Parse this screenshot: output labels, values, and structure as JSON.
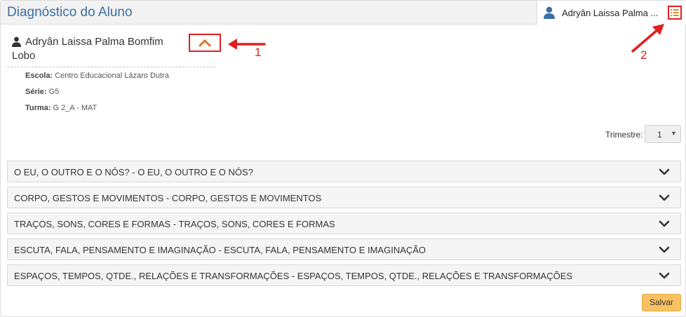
{
  "header": {
    "title": "Diagnóstico do Aluno",
    "user_tab_name": "Adryân Laissa Palma ...",
    "user_icon": "user-icon",
    "list_icon": "list-icon"
  },
  "student": {
    "name": "Adryân Laissa Palma Bomfim Lobo",
    "person_icon": "person-icon",
    "collapse_icon": "chevron-up-icon",
    "escola_label": "Escola:",
    "escola_value": " Centro Educacional Lázaro Dutra",
    "serie_label": "Série:",
    "serie_value": " G5",
    "turma_label": "Turma:",
    "turma_value": " G 2_A - MAT"
  },
  "annotations": {
    "one": "1",
    "two": "2"
  },
  "trimestre": {
    "label": "Trimestre:",
    "selected": "1"
  },
  "accordion": [
    {
      "label": "O EU, O OUTRO E O NÓS? - O EU, O OUTRO E O NÓS?"
    },
    {
      "label": "CORPO, GESTOS E MOVIMENTOS - CORPO, GESTOS E MOVIMENTOS"
    },
    {
      "label": "TRAÇOS, SONS, CORES E FORMAS - TRAÇOS, SONS, CORES E FORMAS"
    },
    {
      "label": "ESCUTA, FALA, PENSAMENTO E IMAGINAÇÃO - ESCUTA, FALA, PENSAMENTO E IMAGINAÇÃO"
    },
    {
      "label": "ESPAÇOS, TEMPOS, QTDE., RELAÇÕES E TRANSFORMAÇÕES - ESPAÇOS, TEMPOS, QTDE., RELAÇÕES E TRANSFORMAÇÕES"
    }
  ],
  "actions": {
    "save_label": "Salvar"
  },
  "colors": {
    "title_blue": "#3a6fa3",
    "annotation_red": "#e02020",
    "chevron_orange": "#e07020",
    "save_yellow": "#f9c162"
  }
}
